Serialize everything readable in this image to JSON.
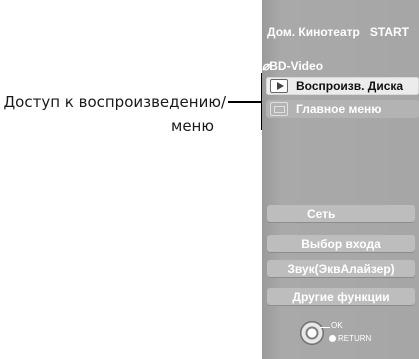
{
  "callout": {
    "line1": "Доступ к воспроизведению/",
    "line2": "меню"
  },
  "panel": {
    "title": "Дом. Кинотеатр",
    "start": "START",
    "disc_label": "BD-Video",
    "disc_icon": "disc-icon",
    "items": [
      {
        "label": "Воспроизв. Диска",
        "icon": "play-icon",
        "selected": true
      },
      {
        "label": "Главное меню",
        "icon": "menu-icon",
        "selected": false
      }
    ],
    "buttons": [
      {
        "label": "Сеть"
      },
      {
        "label": "Выбор входа"
      },
      {
        "label": "Звук(ЭквАлайзер)"
      },
      {
        "label": "Другие функции"
      }
    ],
    "legend": {
      "ok": "OK",
      "return": "RETURN",
      "icon": "directional-pad-icon"
    }
  }
}
